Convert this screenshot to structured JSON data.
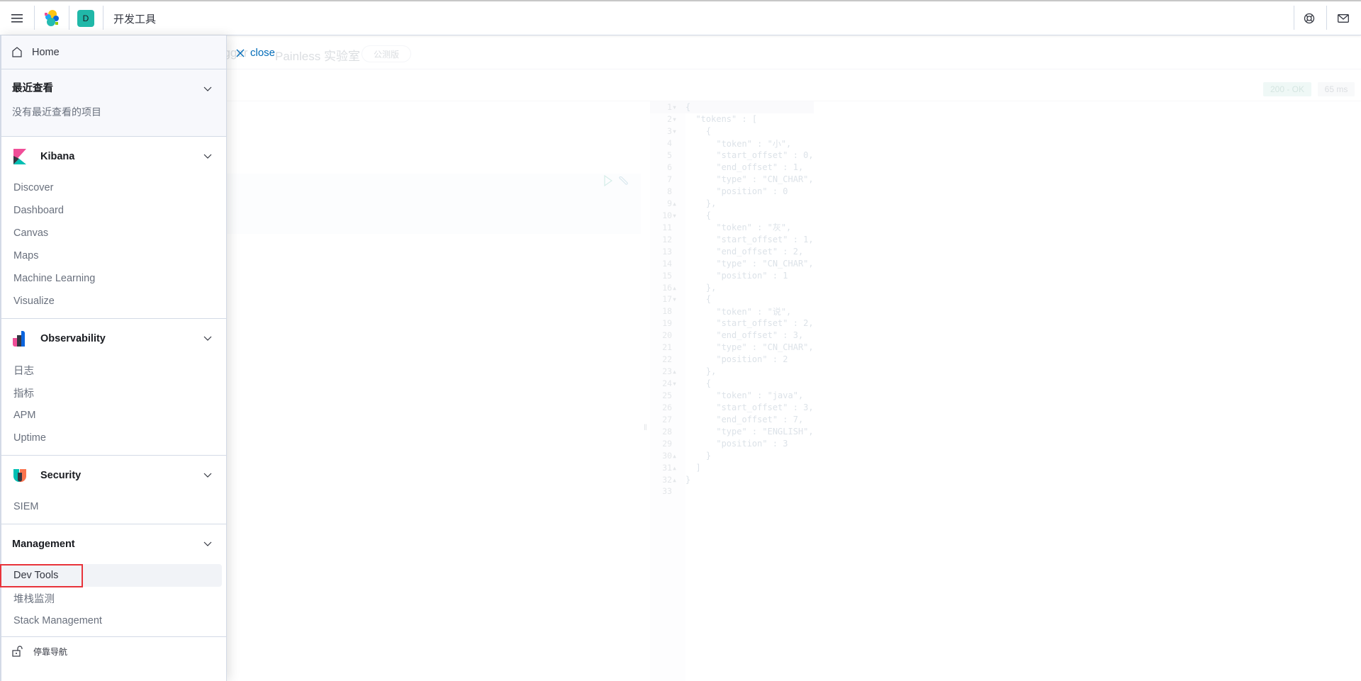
{
  "header": {
    "title": "开发工具",
    "avatar_letter": "D",
    "icons": [
      "menu-icon",
      "elastic-logo",
      "help-icon",
      "mail-icon"
    ]
  },
  "main": {
    "tabs": [
      {
        "label": "ogger"
      },
      {
        "label": "Painless 实验室"
      }
    ],
    "beta_badge": "公测版",
    "close_label": "close",
    "status": {
      "code": "200 - OK",
      "time": "65 ms",
      "ok_color": "#e6f4f1"
    },
    "output_lines": [
      "{",
      "  \"tokens\" : [",
      "    {",
      "      \"token\" : \"小\",",
      "      \"start_offset\" : 0,",
      "      \"end_offset\" : 1,",
      "      \"type\" : \"CN_CHAR\",",
      "      \"position\" : 0",
      "    },",
      "    {",
      "      \"token\" : \"灰\",",
      "      \"start_offset\" : 1,",
      "      \"end_offset\" : 2,",
      "      \"type\" : \"CN_CHAR\",",
      "      \"position\" : 1",
      "    },",
      "    {",
      "      \"token\" : \"说\",",
      "      \"start_offset\" : 2,",
      "      \"end_offset\" : 3,",
      "      \"type\" : \"CN_CHAR\",",
      "      \"position\" : 2",
      "    },",
      "    {",
      "      \"token\" : \"java\",",
      "      \"start_offset\" : 3,",
      "      \"end_offset\" : 7,",
      "      \"type\" : \"ENGLISH\",",
      "      \"position\" : 3",
      "    }",
      "  ]",
      "}",
      ""
    ]
  },
  "nav": {
    "home": "Home",
    "recent": {
      "title": "最近查看",
      "empty": "没有最近查看的项目"
    },
    "kibana": {
      "title": "Kibana",
      "items": [
        "Discover",
        "Dashboard",
        "Canvas",
        "Maps",
        "Machine Learning",
        "Visualize"
      ]
    },
    "observability": {
      "title": "Observability",
      "items": [
        "日志",
        "指标",
        "APM",
        "Uptime"
      ]
    },
    "security": {
      "title": "Security",
      "items": [
        "SIEM"
      ]
    },
    "management": {
      "title": "Management",
      "items": [
        "Dev Tools",
        "堆栈监测",
        "Stack Management"
      ],
      "selected": "Dev Tools"
    },
    "dock": "停靠导航",
    "highlight_color": "#e8333a"
  }
}
